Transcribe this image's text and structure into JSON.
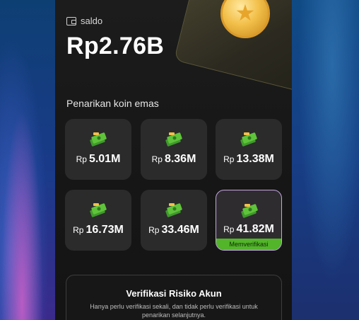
{
  "wallet": {
    "label": "saldo",
    "balance": "Rp2.76B"
  },
  "withdraw": {
    "title": "Penarikan koin emas",
    "options": [
      {
        "currency": "Rp",
        "amount": "5.01M",
        "selected": false
      },
      {
        "currency": "Rp",
        "amount": "8.36M",
        "selected": false
      },
      {
        "currency": "Rp",
        "amount": "13.38M",
        "selected": false
      },
      {
        "currency": "Rp",
        "amount": "16.73M",
        "selected": false
      },
      {
        "currency": "Rp",
        "amount": "33.46M",
        "selected": false
      },
      {
        "currency": "Rp",
        "amount": "41.82M",
        "selected": true,
        "badge": "Memverifikasi"
      }
    ]
  },
  "risk": {
    "title": "Verifikasi Risiko Akun",
    "description": "Hanya perlu verifikasi sekali, dan tidak perlu verifikasi untuk penarikan selanjutnya."
  },
  "icons": {
    "wallet": "wallet-icon",
    "money": "money-stack-icon",
    "coin": "gold-coin-star-icon"
  },
  "colors": {
    "accent_green": "#52b52a",
    "selected_border": "#c4a7e0",
    "tile_bg": "#2b2b2b",
    "phone_bg": "#1c1c1c"
  }
}
